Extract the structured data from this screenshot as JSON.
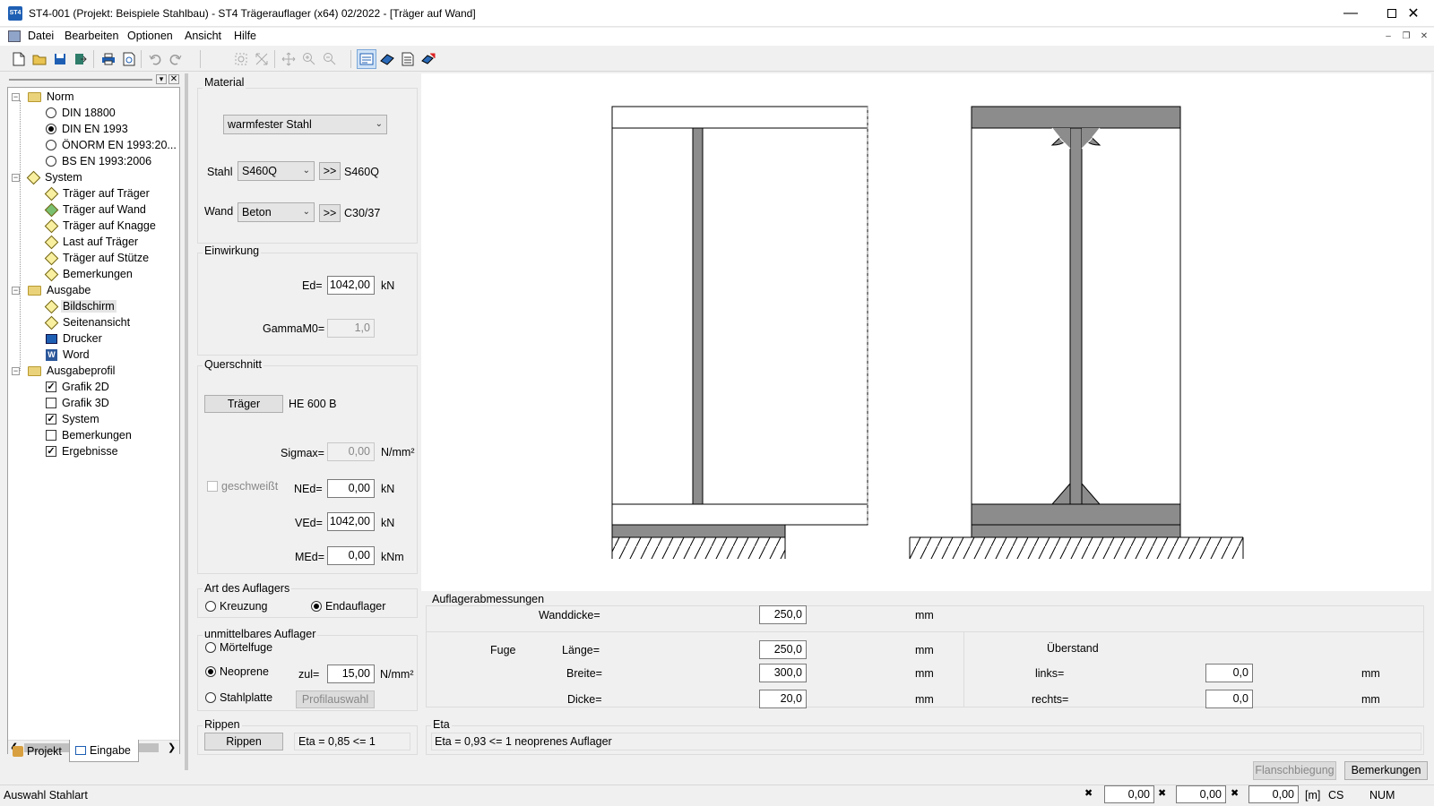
{
  "window": {
    "title": "ST4-001 (Projekt: Beispiele Stahlbau) - ST4 Trägerauflager (x64) 02/2022 - [Träger auf Wand]",
    "app_icon": "ST4"
  },
  "menu": [
    "Datei",
    "Bearbeiten",
    "Optionen",
    "Ansicht",
    "Hilfe"
  ],
  "tree": {
    "norm": {
      "label": "Norm",
      "items": [
        "DIN 18800",
        "DIN EN 1993",
        "ÖNORM EN 1993:20...",
        "BS EN 1993:2006"
      ],
      "selected_index": 1
    },
    "system": {
      "label": "System",
      "items": [
        "Träger auf Träger",
        "Träger auf Wand",
        "Träger auf Knagge",
        "Last auf Träger",
        "Träger auf Stütze",
        "Bemerkungen"
      ]
    },
    "ausgabe": {
      "label": "Ausgabe",
      "items": [
        "Bildschirm",
        "Seitenansicht",
        "Drucker",
        "Word"
      ]
    },
    "ausgabeprofil": {
      "label": "Ausgabeprofil",
      "items": [
        {
          "label": "Grafik 2D",
          "checked": true
        },
        {
          "label": "Grafik 3D",
          "checked": false
        },
        {
          "label": "System",
          "checked": true
        },
        {
          "label": "Bemerkungen",
          "checked": false
        },
        {
          "label": "Ergebnisse",
          "checked": true
        }
      ]
    }
  },
  "bottom_tabs": [
    "Projekt",
    "Eingabe"
  ],
  "material": {
    "group_label": "Material",
    "type": "warmfester Stahl",
    "stahl_label": "Stahl",
    "stahl_value": "S460Q",
    "stahl_result": "S460Q",
    "wand_label": "Wand",
    "wand_value": "Beton",
    "wand_result": "C30/37",
    "arrow_button": ">>"
  },
  "einwirkung": {
    "group_label": "Einwirkung",
    "ed_label": "Ed=",
    "ed_value": "1042,00",
    "ed_unit": "kN",
    "gamma_label": "GammaM0=",
    "gamma_value": "1,0"
  },
  "querschnitt": {
    "group_label": "Querschnitt",
    "traeger_button": "Träger",
    "profile": "HE  600 B",
    "sigmax_label": "Sigmax=",
    "sigmax_value": "0,00",
    "sigmax_unit": "N/mm²",
    "geschweisst_label": "geschweißt",
    "ned_label": "NEd=",
    "ned_value": "0,00",
    "ned_unit": "kN",
    "ved_label": "VEd=",
    "ved_value": "1042,00",
    "ved_unit": "kN",
    "med_label": "MEd=",
    "med_value": "0,00",
    "med_unit": "kNm"
  },
  "auflager_art": {
    "group_label": "Art des Auflagers",
    "options": [
      "Kreuzung",
      "Endauflager"
    ],
    "selected": "Endauflager"
  },
  "unmittelbar": {
    "group_label": "unmittelbares Auflager",
    "options": [
      "Mörtelfuge",
      "Neoprene",
      "Stahlplatte"
    ],
    "selected": "Neoprene",
    "zul_label": "zul=",
    "zul_value": "15,00",
    "zul_unit": "N/mm²",
    "profilauswahl_button": "Profilauswahl"
  },
  "rippen": {
    "group_label": "Rippen",
    "button": "Rippen",
    "eta_text": "Eta = 0,85 <= 1"
  },
  "auflagerabmessungen": {
    "group_label": "Auflagerabmessungen",
    "wanddicke_label": "Wanddicke=",
    "wanddicke_value": "250,0",
    "unit": "mm",
    "fuge_label": "Fuge",
    "laenge_label": "Länge=",
    "laenge_value": "250,0",
    "breite_label": "Breite=",
    "breite_value": "300,0",
    "dicke_label": "Dicke=",
    "dicke_value": "20,0",
    "ueberstand_label": "Überstand",
    "links_label": "links=",
    "links_value": "0,0",
    "rechts_label": "rechts=",
    "rechts_value": "0,0"
  },
  "eta": {
    "group_label": "Eta",
    "text": "Eta =  0,93 <= 1    neoprenes Auflager"
  },
  "buttons": {
    "flanschbiegung": "Flanschbiegung",
    "bemerkungen": "Bemerkungen"
  },
  "status": {
    "message": "Auswahl Stahlart",
    "x_value": "0,00",
    "y_value": "0,00",
    "z_value": "0,00",
    "unit": "[m]",
    "cs": "CS",
    "num": "NUM"
  },
  "colors": {
    "steel_fill": "#8c8c8c",
    "accent": "#1e5fb4"
  }
}
